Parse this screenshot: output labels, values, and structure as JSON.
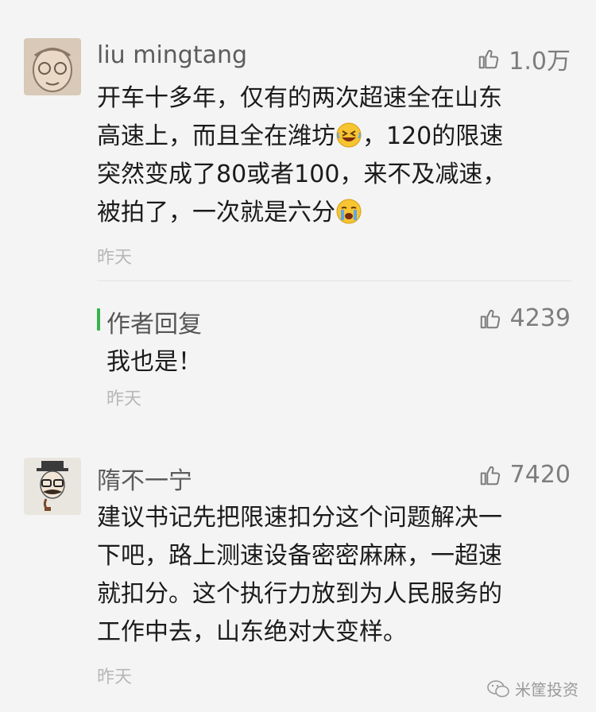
{
  "comments": [
    {
      "user": "liu mingtang",
      "likes": "1.0万",
      "lines": [
        "开车十多年，仅有的两次超速全在山东",
        "高速上，而且全在潍坊",
        "，120的限速",
        "突然变成了80或者100，来不及减速，",
        "被拍了，一次就是六分"
      ],
      "time": "昨天",
      "reply": {
        "label": "作者回复",
        "likes": "4239",
        "text": "我也是！",
        "time": "昨天"
      }
    },
    {
      "user": "隋不一宁",
      "likes": "7420",
      "lines": [
        "建议书记先把限速扣分这个问题解决一",
        "下吧，路上测速设备密密麻麻，一超速",
        "就扣分。这个执行力放到为人民服务的",
        "工作中去，山东绝对大变样。"
      ],
      "time": "昨天"
    }
  ],
  "watermark": "米筐投资",
  "icons": {
    "like": "thumbs-up-icon",
    "emoji1": "grinning-squint-emoji-icon",
    "emoji2": "crying-emoji-icon",
    "watermark": "wechat-icon"
  },
  "colors": {
    "reply_bar": "#37b24d",
    "background": "#f4f4f4"
  }
}
